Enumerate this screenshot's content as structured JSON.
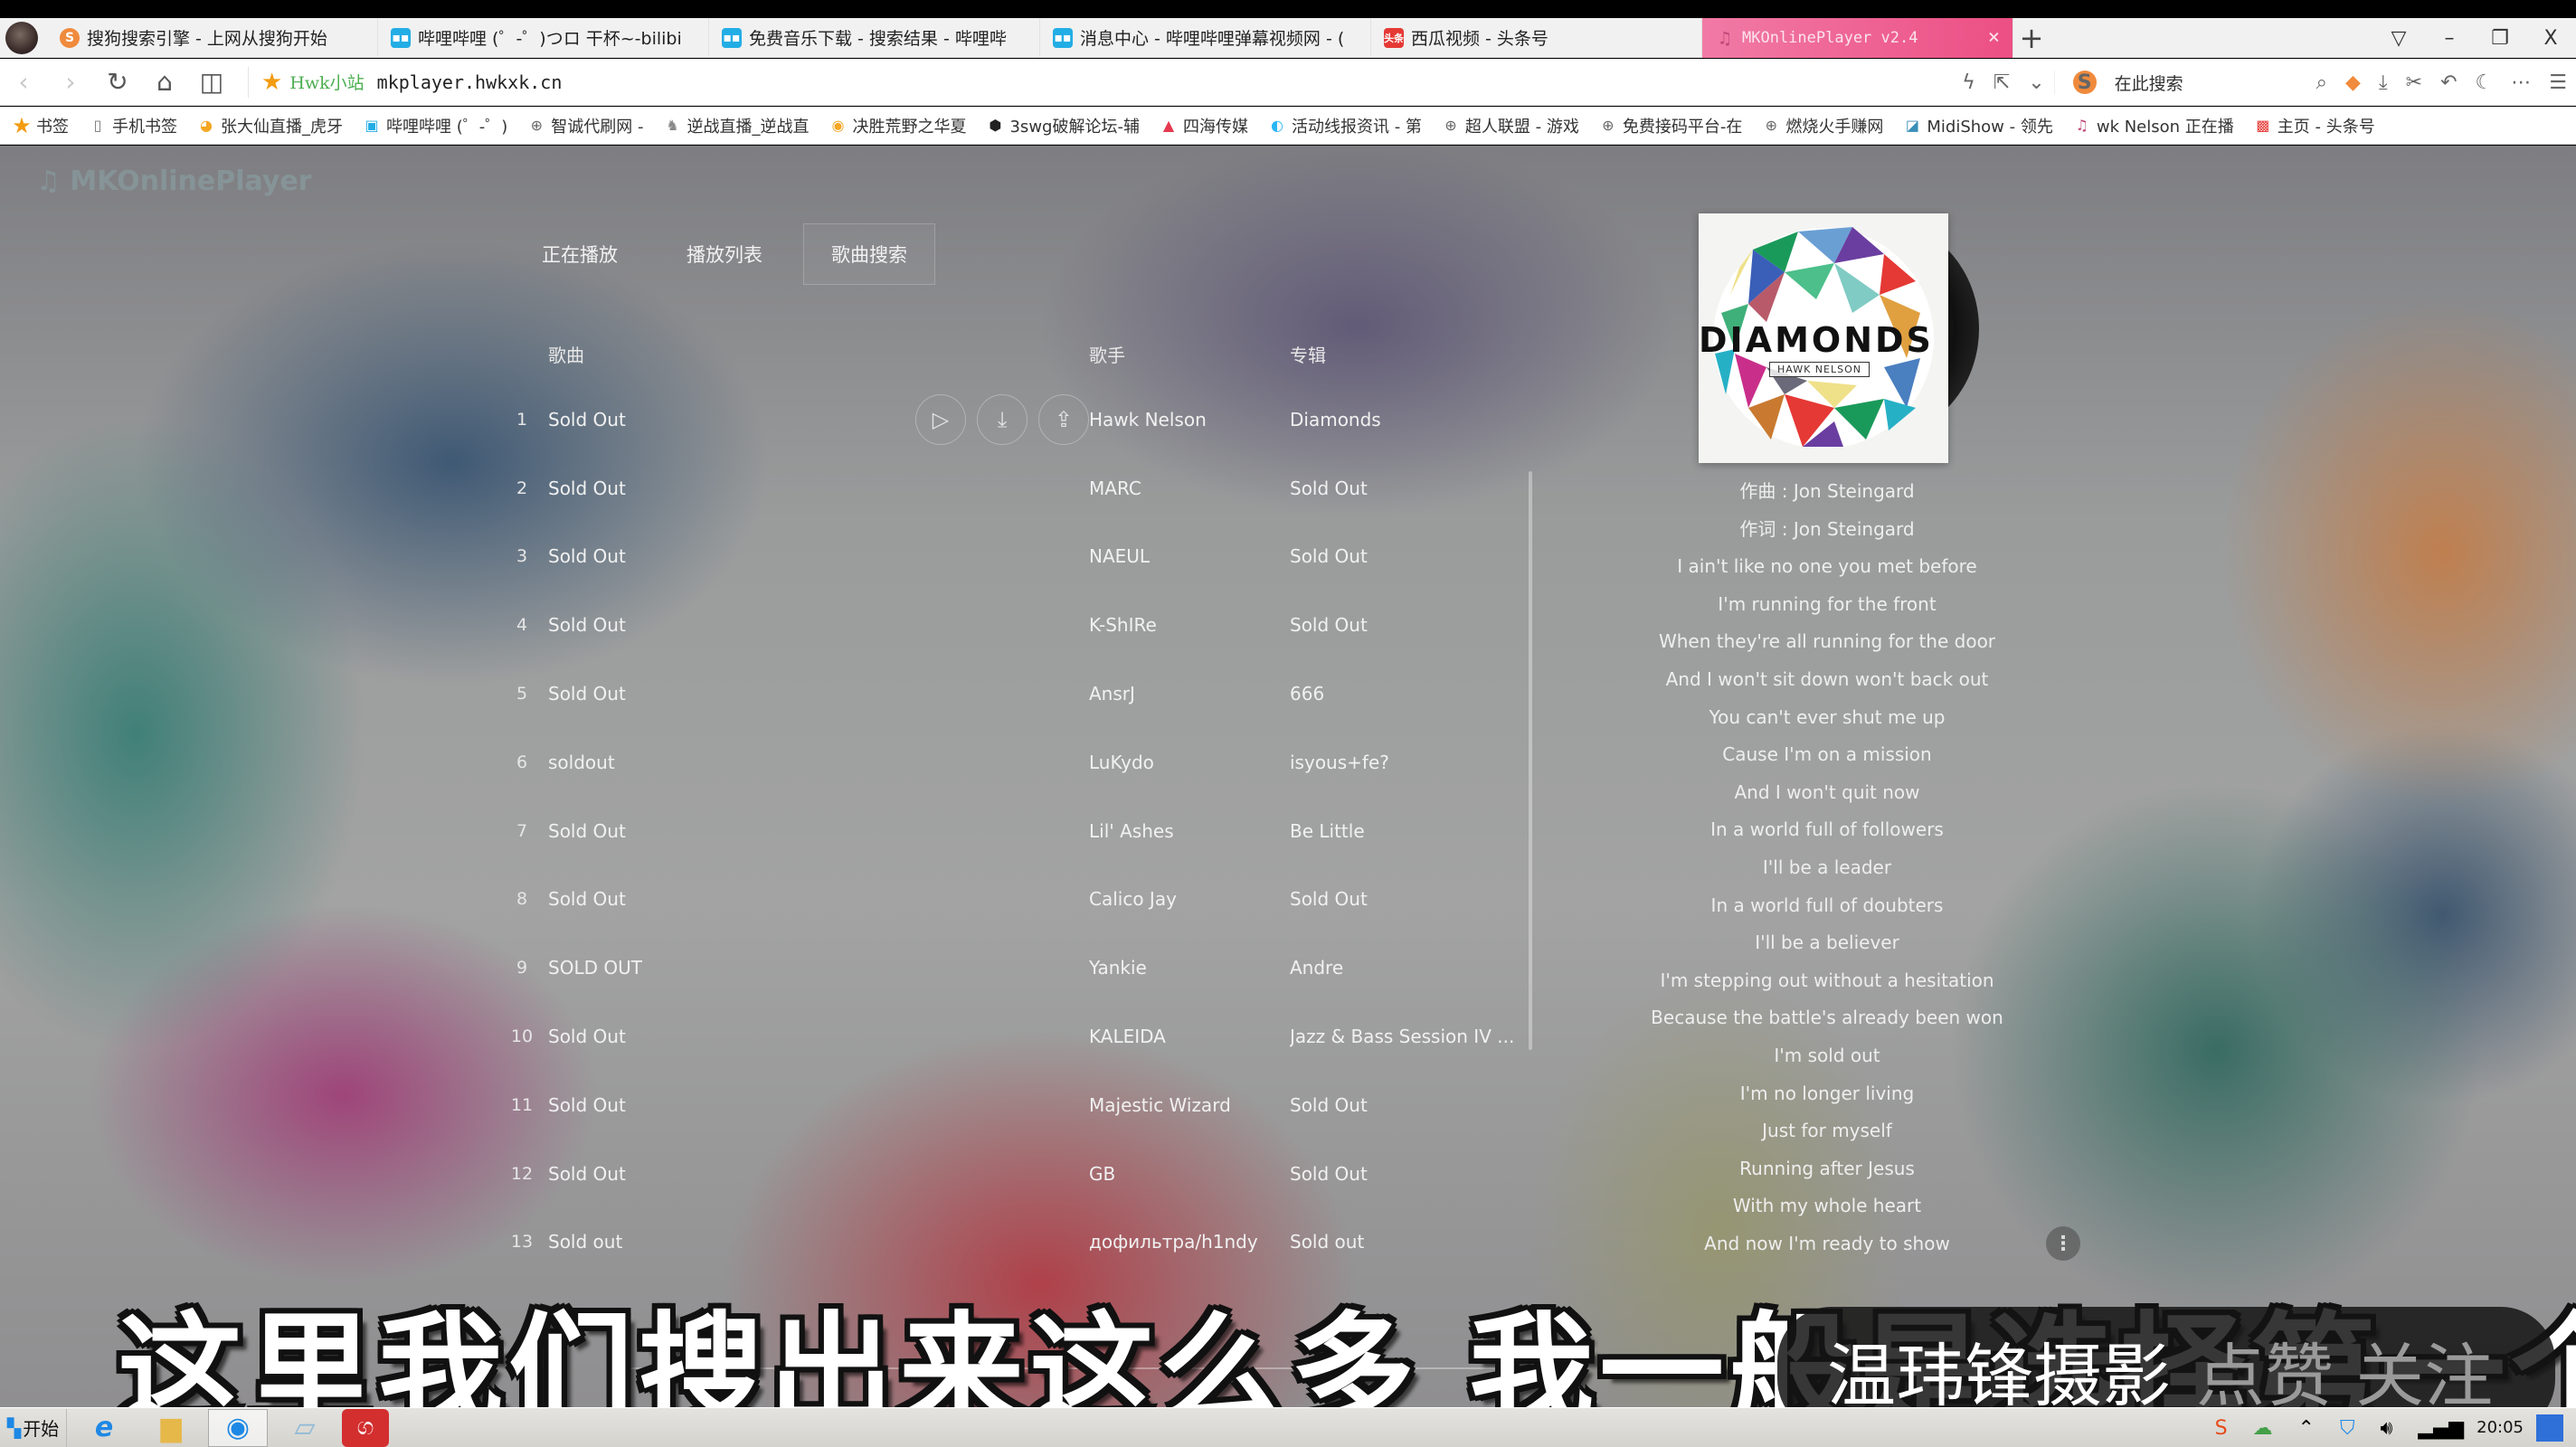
{
  "browser": {
    "tabs": [
      {
        "icon": "sogou-icon",
        "label": "搜狗搜索引擎 - 上网从搜狗开始"
      },
      {
        "icon": "bilibili-icon",
        "label": "哔哩哔哩 (゜-゜)つロ 干杯~-bilibi"
      },
      {
        "icon": "bilibili-icon",
        "label": "免费音乐下载 - 搜索结果 - 哔哩哔"
      },
      {
        "icon": "bilibili-icon",
        "label": "消息中心 - 哔哩哔哩弹幕视频网 - ("
      },
      {
        "icon": "toutiao-icon",
        "label": "西瓜视频 - 头条号"
      }
    ],
    "active_tab": {
      "icon": "music-note-icon",
      "label": "MKOnlinePlayer v2.4",
      "close": "×"
    },
    "new_tab": "+",
    "window_controls": {
      "menu": "▽",
      "minimize": "–",
      "restore": "❐",
      "close": "X"
    },
    "address": {
      "site_name": "Hwk小站",
      "url": "mkplayer.hwkxk.cn"
    },
    "search_placeholder": "在此搜索",
    "bookmarks": [
      {
        "icon": "star-icon",
        "label": "书签"
      },
      {
        "icon": "phone-icon",
        "label": "手机书签"
      },
      {
        "icon": "huya-icon",
        "label": "张大仙直播_虎牙"
      },
      {
        "icon": "bilibili-icon",
        "label": "哔哩哔哩 (゜-゜)"
      },
      {
        "icon": "globe-icon",
        "label": "智诚代刷网 -"
      },
      {
        "icon": "game-icon",
        "label": "逆战直播_逆战直"
      },
      {
        "icon": "location-icon",
        "label": "决胜荒野之华夏"
      },
      {
        "icon": "cube-icon",
        "label": "3swg破解论坛-辅"
      },
      {
        "icon": "mountain-icon",
        "label": "四海传媒"
      },
      {
        "icon": "drop-icon",
        "label": "活动线报资讯 - 第"
      },
      {
        "icon": "globe-icon",
        "label": "超人联盟 - 游戏"
      },
      {
        "icon": "globe-icon",
        "label": "免费接码平台-在"
      },
      {
        "icon": "globe-icon",
        "label": "燃烧火手赚网"
      },
      {
        "icon": "midishow-icon",
        "label": "MidiShow - 领先"
      },
      {
        "icon": "music-note-icon",
        "label": "wk Nelson 正在播"
      },
      {
        "icon": "toutiao-icon",
        "label": "主页 - 头条号"
      }
    ]
  },
  "app": {
    "logo": "♫ MKOnlinePlayer",
    "nav_tabs": [
      {
        "label": "正在播放",
        "active": false
      },
      {
        "label": "播放列表",
        "active": false
      },
      {
        "label": "歌曲搜索",
        "active": true
      }
    ],
    "columns": {
      "song": "歌曲",
      "artist": "歌手",
      "album": "专辑"
    },
    "songs": [
      {
        "num": "1",
        "title": "Sold Out",
        "artist": "Hawk Nelson",
        "album": "Diamonds"
      },
      {
        "num": "2",
        "title": "Sold Out",
        "artist": "MARC",
        "album": "Sold Out"
      },
      {
        "num": "3",
        "title": "Sold Out",
        "artist": "NAEUL",
        "album": "Sold Out"
      },
      {
        "num": "4",
        "title": "Sold Out",
        "artist": "K-ShIRe",
        "album": "Sold Out"
      },
      {
        "num": "5",
        "title": "Sold Out",
        "artist": "AnsrJ",
        "album": "666"
      },
      {
        "num": "6",
        "title": "soldout",
        "artist": "LuKydo",
        "album": "isyous+fe?"
      },
      {
        "num": "7",
        "title": "Sold Out",
        "artist": "Lil' Ashes",
        "album": "Be Little"
      },
      {
        "num": "8",
        "title": "Sold Out",
        "artist": "Calico Jay",
        "album": "Sold Out"
      },
      {
        "num": "9",
        "title": "SOLD OUT",
        "artist": "Yankie",
        "album": "Andre"
      },
      {
        "num": "10",
        "title": "Sold Out",
        "artist": "KALEIDA",
        "album": "Jazz & Bass Session IV ..."
      },
      {
        "num": "11",
        "title": "Sold Out",
        "artist": "Majestic Wizard",
        "album": "Sold Out"
      },
      {
        "num": "12",
        "title": "Sold Out",
        "artist": "GB",
        "album": "Sold Out"
      },
      {
        "num": "13",
        "title": "Sold out",
        "artist": "дофильтра/h1ndy",
        "album": "Sold out"
      }
    ],
    "row_actions": {
      "play": "▷",
      "download": "⤓",
      "share": "⇪"
    },
    "now_playing": {
      "cover_title": "DIAMONDS",
      "cover_artist": "HAWK NELSON"
    },
    "lyrics": [
      "作曲 : Jon Steingard",
      "作词 : Jon Steingard",
      "I ain't like no one you met before",
      "I'm running for the front",
      "When they're all running for the door",
      "And I won't sit down won't back out",
      "You can't ever shut me up",
      "Cause I'm on a mission",
      "And I won't quit now",
      "In a world full of followers",
      "I'll be a leader",
      "In a world full of doubters",
      "I'll be a believer",
      "I'm stepping out without a hesitation",
      "Because the battle's already been won",
      "I'm sold out",
      "I'm no longer living",
      "Just for myself",
      "Running after Jesus",
      "With my whole heart",
      "And now I'm ready to show"
    ],
    "more_button": "⋮",
    "play_glyph": "▶"
  },
  "overlay": {
    "subtitle": "这里我们搜出来这么多  我一般是选择第一个",
    "watermark_main": "温玮锋摄影",
    "watermark_sub": "点赞 关注"
  },
  "taskbar": {
    "start_label": "开始",
    "clock_time": "20:05"
  }
}
